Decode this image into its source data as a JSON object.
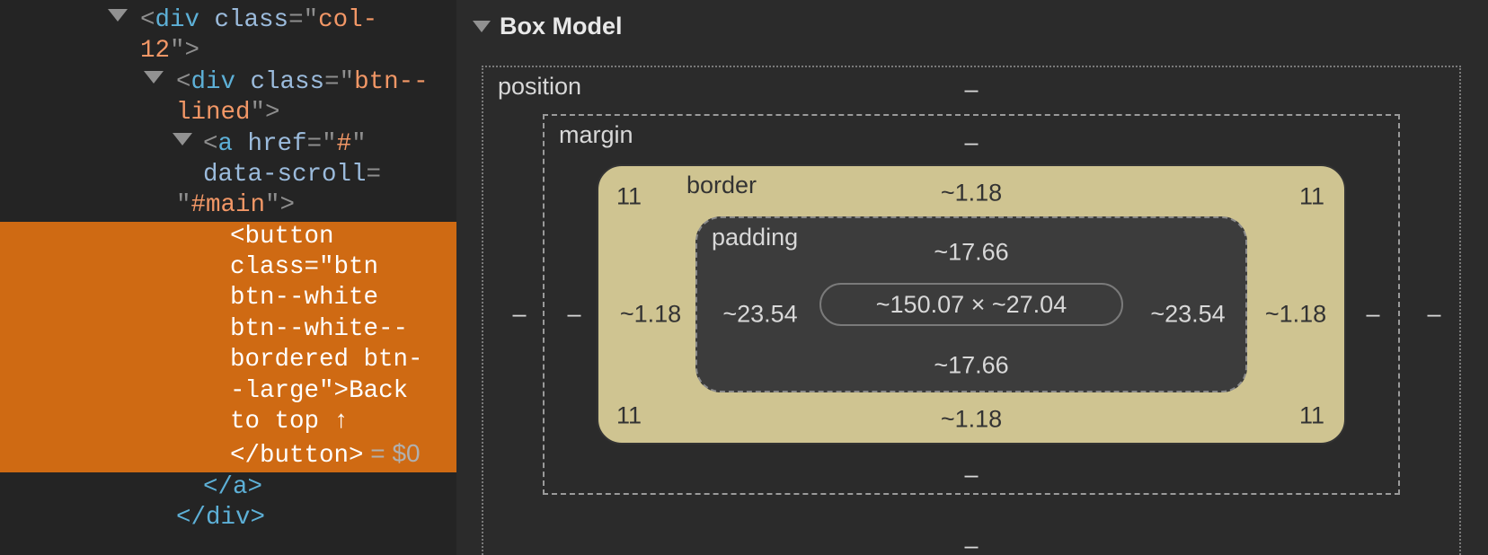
{
  "dom": {
    "n1": {
      "open": "<div class=\"col-12\">",
      "parts": {
        "p1": "<",
        "tag": "div",
        "sp": " ",
        "an": "class",
        "eq": "=",
        "q": "\"",
        "av": "col-12",
        "cl": ">"
      }
    },
    "n2": {
      "parts": {
        "p1": "<",
        "tag": "div",
        "sp": " ",
        "an": "class",
        "eq": "=",
        "q": "\"",
        "av": "btn--lined",
        "cl": ">"
      }
    },
    "n3": {
      "parts": {
        "p1": "<",
        "tag": "a",
        "sp": " ",
        "an1": "href",
        "eq": "=",
        "q": "\"",
        "av1": "#",
        "an2": "data-scroll",
        "av2": "#main",
        "cl": ">"
      }
    },
    "n4": {
      "parts": {
        "p1": "<",
        "tag": "button",
        "sp": " ",
        "an": "class",
        "eq": "=",
        "q": "\"",
        "av": "btn btn--white btn--white--bordered btn--large",
        "cl": ">",
        "txt": "Back to top ↑",
        "ct": "</button>"
      }
    },
    "eq0": " = $0",
    "close_a": "</a>",
    "close_div": "</div>"
  },
  "box_model": {
    "title": "Box Model",
    "position": {
      "label": "position",
      "top": "–",
      "right": "–",
      "bottom": "–",
      "left": "–"
    },
    "margin": {
      "label": "margin",
      "top": "–",
      "right": "–",
      "bottom": "–",
      "left": "–"
    },
    "border": {
      "label": "border",
      "top": "~1.18",
      "right": "~1.18",
      "bottom": "~1.18",
      "left": "~1.18",
      "corner": "11"
    },
    "padding": {
      "label": "padding",
      "top": "~17.66",
      "right": "~23.54",
      "bottom": "~17.66",
      "left": "~23.54"
    },
    "content": "~150.07 × ~27.04"
  }
}
